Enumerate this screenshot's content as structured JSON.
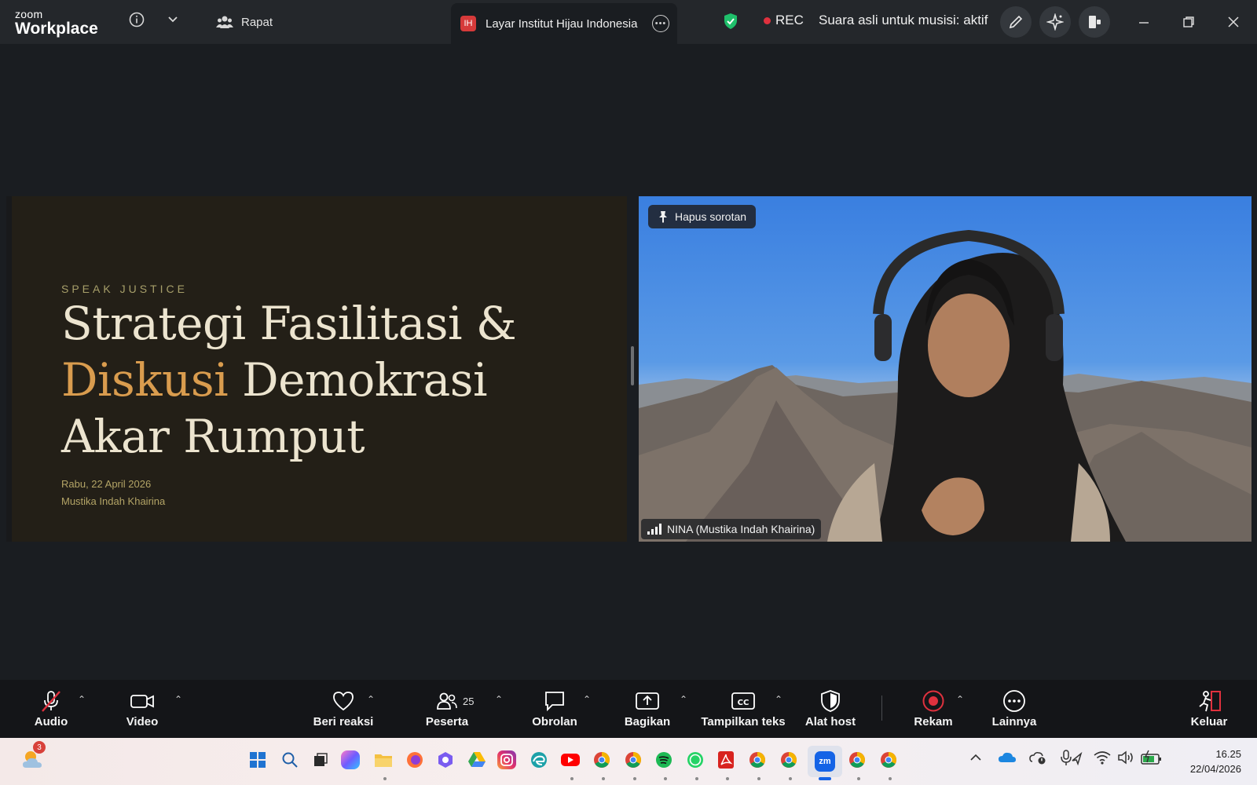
{
  "titlebar": {
    "logo_small": "zoom",
    "logo_big": "Workplace",
    "meeting_label": "Rapat",
    "tab_badge": "IH",
    "tab_label": "Layar Institut Hijau Indonesia",
    "rec_label": "REC",
    "audio_status": "Suara asli untuk musisi: aktif"
  },
  "slide": {
    "eyebrow": "SPEAK JUSTICE",
    "line1": "Strategi Fasilitasi &",
    "line2_accent": "Diskusi",
    "line2_rest": " Demokrasi",
    "line3": "Akar Rumput",
    "date": "Rabu, 22 April 2026",
    "author": "Mustika Indah Khairina"
  },
  "video": {
    "pin_label": "Hapus sorotan",
    "participant_name": "NINA (Mustika Indah Khairina)"
  },
  "toolbar": {
    "audio": "Audio",
    "video": "Video",
    "react": "Beri reaksi",
    "participants": "Peserta",
    "participant_count": "25",
    "chat": "Obrolan",
    "share": "Bagikan",
    "captions": "Tampilkan teks",
    "host_tools": "Alat host",
    "record": "Rekam",
    "more": "Lainnya",
    "leave": "Keluar"
  },
  "taskbar": {
    "weather_badge": "3",
    "time": "16.25",
    "date": "22/04/2026"
  },
  "colors": {
    "accent_gold": "#d99c4e",
    "rec_red": "#e0313e",
    "shield_green": "#1fc06b"
  }
}
